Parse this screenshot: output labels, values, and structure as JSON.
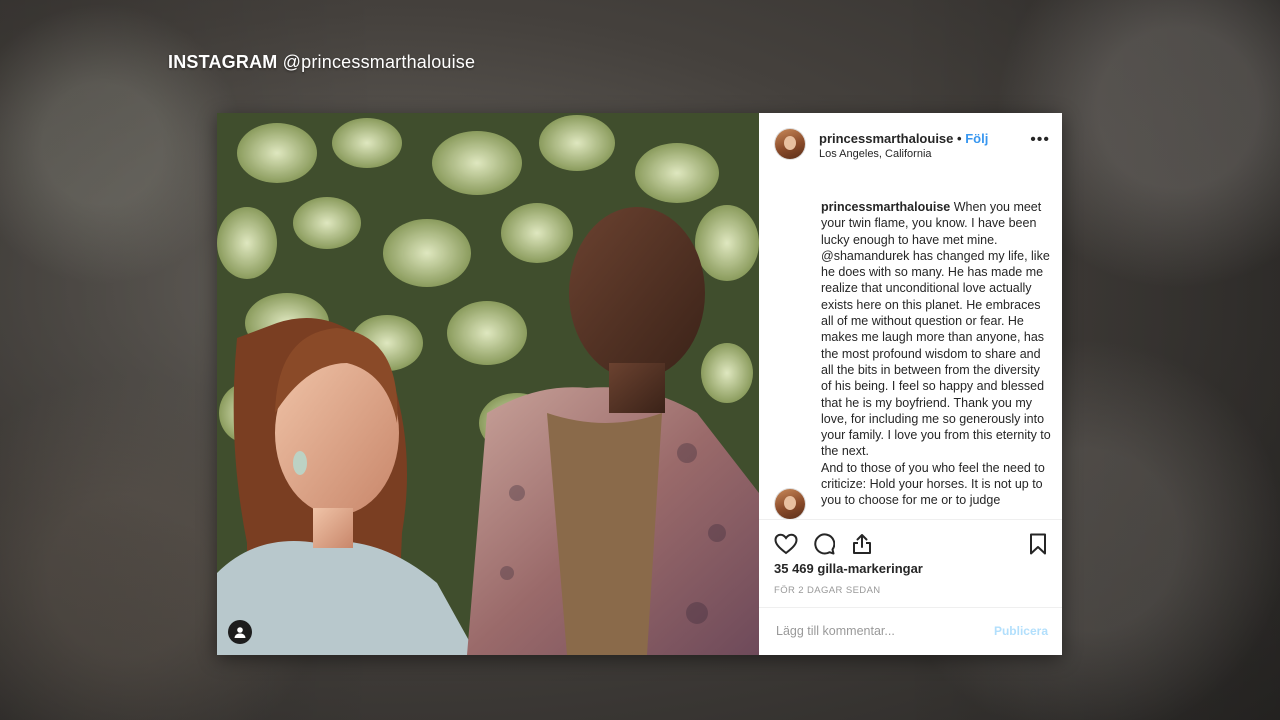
{
  "overlay": {
    "source_label": "INSTAGRAM",
    "handle": "@princessmarthalouise"
  },
  "post": {
    "username": "princessmarthalouise",
    "separator": "•",
    "follow_label": "Följ",
    "location": "Los Angeles, California",
    "more_label": "•••",
    "caption_username": "princessmarthalouise",
    "caption_text": " When you meet your twin flame, you know. I have been lucky enough to have met mine. @shamandurek has changed my life, like he does with so many. He has made me realize that unconditional love actually exists here on this planet. He embraces all of me without question or fear. He makes me laugh more than anyone, has the most profound wisdom to share and all the bits in between from the diversity of his being. I feel so happy and blessed that he is my boyfriend. Thank you my love, for including me so generously into your family. I love you from this eternity to the next.",
    "caption_text_2": "And to those of you who feel the need to criticize: Hold your horses. It is not up to you to choose for me or to judge",
    "likes": "35 469 gilla-markeringar",
    "time_ago": "FÖR 2 DAGAR SEDAN",
    "comment_placeholder": "Lägg till kommentar...",
    "publish_label": "Publicera"
  },
  "icons": [
    "heart-icon",
    "comment-icon",
    "share-icon",
    "bookmark-icon",
    "user-tag-icon"
  ],
  "colors": {
    "follow": "#3897f0",
    "publish_disabled": "#b2dffc",
    "text": "#262626",
    "muted": "#999999"
  }
}
